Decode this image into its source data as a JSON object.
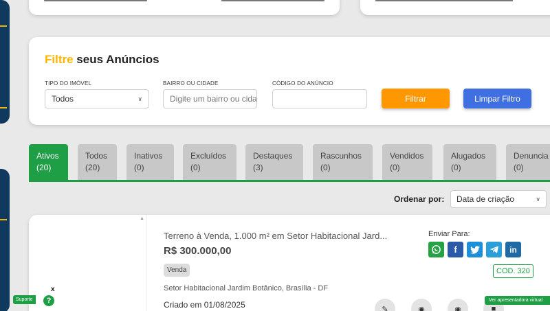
{
  "filter": {
    "title_highlight": "Filtre",
    "title_rest": " seus Anúncios",
    "type_label": "TIPO DO IMÓVEL",
    "type_value": "Todos",
    "bairro_label": "BAIRRO OU CIDADE",
    "bairro_placeholder": "Digite um bairro ou cidade",
    "codigo_label": "CÓDIGO DO ANÚNCIO",
    "codigo_value": "",
    "filter_button": "Filtrar",
    "clear_button": "Limpar Filtro"
  },
  "tabs": [
    {
      "label": "Ativos",
      "count": "(20)"
    },
    {
      "label": "Todos",
      "count": "(20)"
    },
    {
      "label": "Inativos",
      "count": "(0)"
    },
    {
      "label": "Excluídos",
      "count": "(0)"
    },
    {
      "label": "Destaques",
      "count": "(3)"
    },
    {
      "label": "Rascunhos",
      "count": "(0)"
    },
    {
      "label": "Vendidos",
      "count": "(0)"
    },
    {
      "label": "Alugados",
      "count": "(0)"
    },
    {
      "label": "Denuncia",
      "count": "(0)"
    }
  ],
  "sort": {
    "label": "Ordenar por:",
    "value": "Data de criação"
  },
  "listing": {
    "title": "Terreno à Venda, 1.000 m² em Setor Habitacional Jard...",
    "price": "R$ 300.000,00",
    "badge": "Venda",
    "location": "Setor Habitacional Jardim Botânico, Brasília - DF",
    "created": "Criado em 01/08/2025",
    "share_label": "Enviar Para:",
    "code": "COD. 320",
    "share_icons": [
      "whatsapp-icon",
      "facebook-icon",
      "twitter-icon",
      "telegram-icon",
      "linkedin-icon"
    ],
    "action_icons": [
      "edit-icon",
      "view-icon",
      "preview-icon",
      "delete-icon"
    ]
  },
  "widgets": {
    "support_label": "Suporte",
    "support_help": "?",
    "support_close": "x",
    "presenter_label": "Ver apresentadora virtual"
  },
  "colors": {
    "accent_yellow": "#ffb400",
    "orange_button": "#ff9800",
    "blue_button": "#3f6fe0",
    "green_active": "#1e9e45",
    "sidebar": "#0f3a5e"
  }
}
